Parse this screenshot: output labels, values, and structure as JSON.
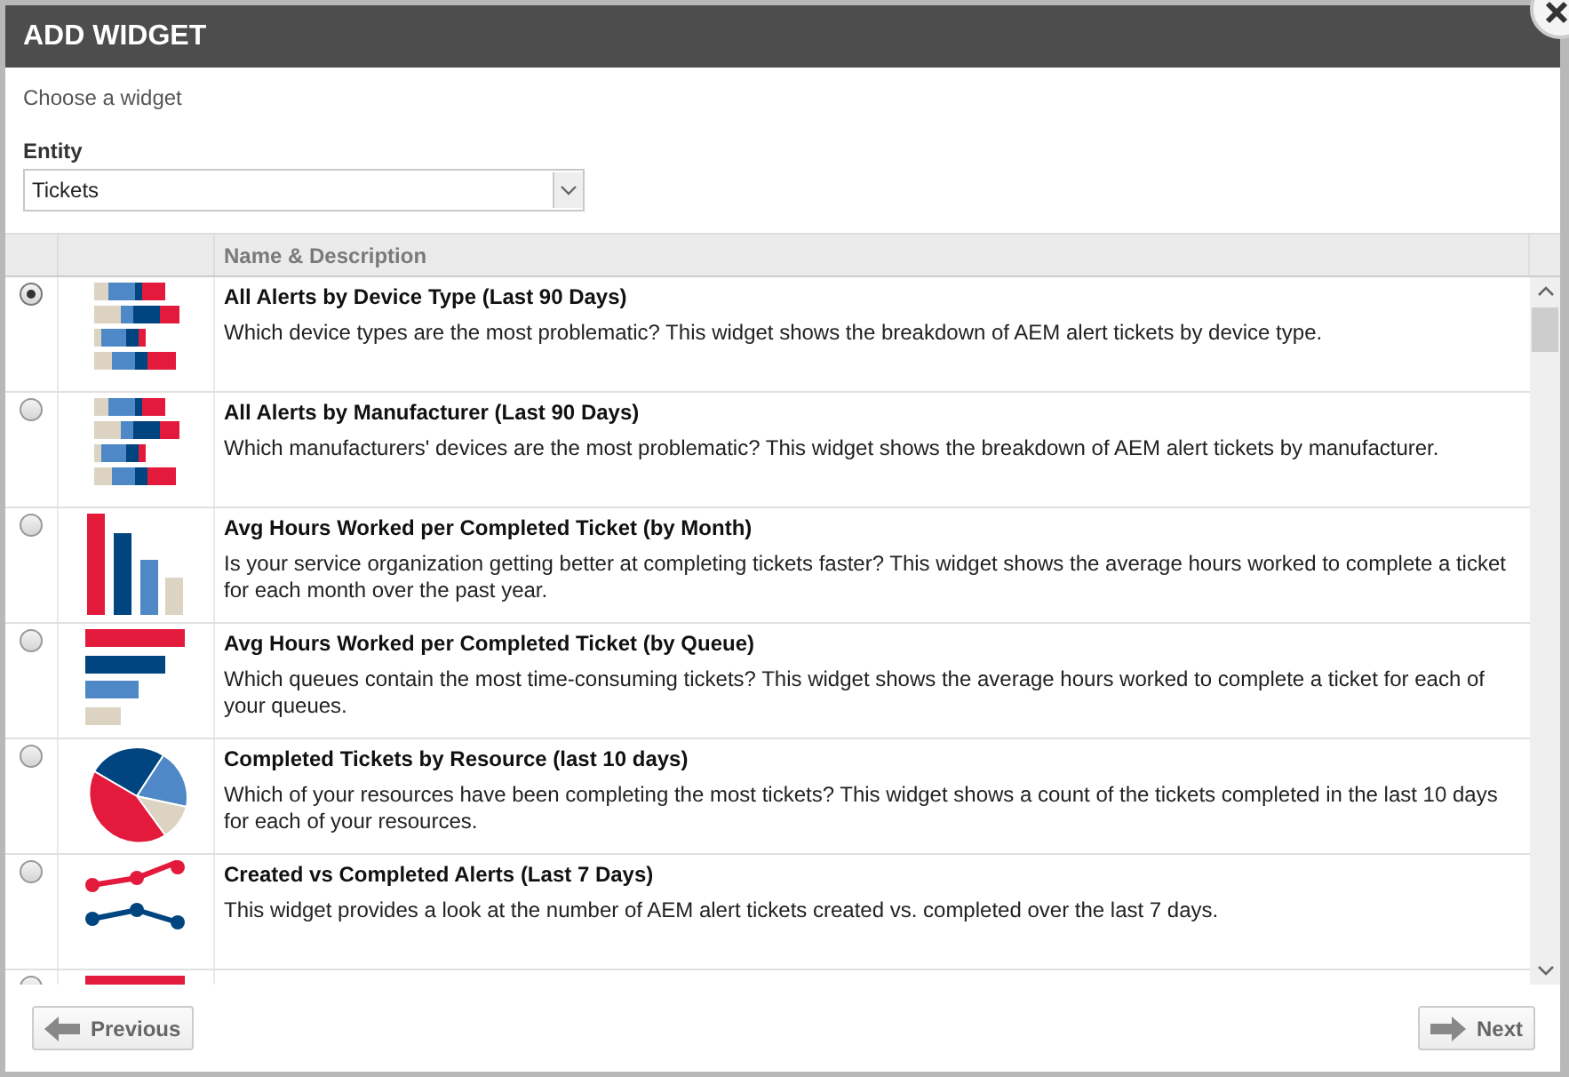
{
  "dialog": {
    "title": "ADD WIDGET",
    "subtitle": "Choose a widget"
  },
  "entity": {
    "label": "Entity",
    "value": "Tickets"
  },
  "table": {
    "columns": [
      "",
      "",
      "Name & Description"
    ],
    "rows": [
      {
        "selected": true,
        "kind": "stacked",
        "title": "All Alerts by Device Type (Last 90 Days)",
        "description": "Which device types are the most problematic? This widget shows the breakdown of AEM alert tickets by device type."
      },
      {
        "selected": false,
        "kind": "stacked",
        "title": "All Alerts by Manufacturer (Last 90 Days)",
        "description": "Which manufacturers' devices are the most problematic? This widget shows the breakdown of AEM alert tickets by manufacturer."
      },
      {
        "selected": false,
        "kind": "vbar",
        "title": "Avg Hours Worked per Completed Ticket (by Month)",
        "description": "Is your service organization getting better at completing tickets faster? This widget shows the average hours worked to complete a ticket for each month over the past year."
      },
      {
        "selected": false,
        "kind": "hbar",
        "title": "Avg Hours Worked per Completed Ticket (by Queue)",
        "description": "Which queues contain the most time-consuming tickets? This widget shows the average hours worked to complete a ticket for each of your queues."
      },
      {
        "selected": false,
        "kind": "pie",
        "title": "Completed Tickets by Resource (last 10 days)",
        "description": "Which of your resources have been completing the most tickets? This widget shows a count of the tickets completed in the last 10 days for each of your resources."
      },
      {
        "selected": false,
        "kind": "line",
        "title": "Created vs Completed Alerts (Last 7 Days)",
        "description": "This widget provides a look at the number of AEM alert tickets created vs. completed over the last 7 days."
      },
      {
        "selected": false,
        "kind": "hbar"
      }
    ]
  },
  "buttons": {
    "previous": "Previous",
    "next": "Next"
  }
}
